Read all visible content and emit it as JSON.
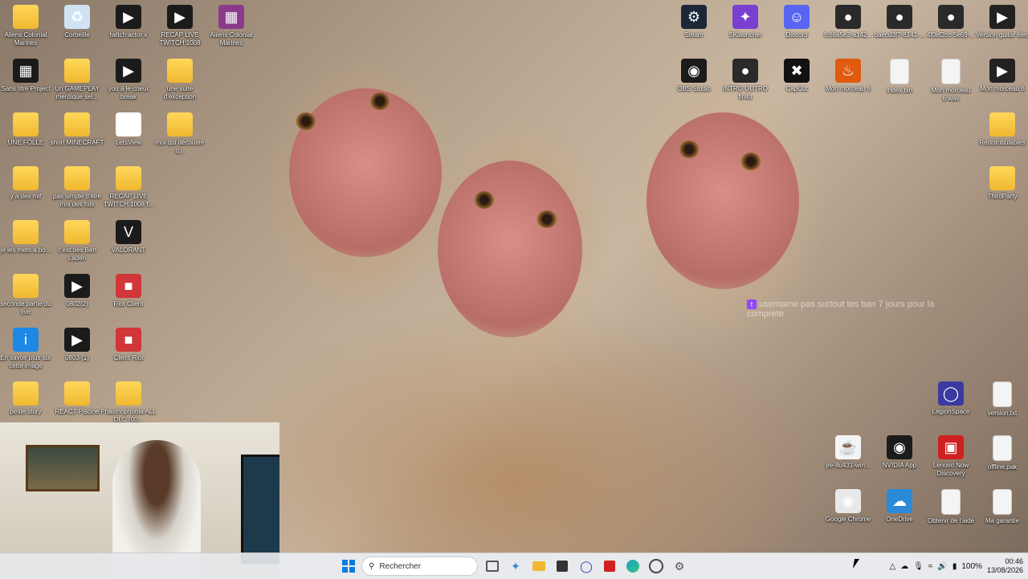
{
  "desktop_icons_left": [
    {
      "label": "Aliens Colonial Marines",
      "icon": "folder-icon"
    },
    {
      "label": "Corbeille",
      "icon": "recycle-bin-icon"
    },
    {
      "label": "twitch actor x",
      "icon": "video-file-icon"
    },
    {
      "label": "RECAP LIVE TWITCH 1008",
      "icon": "video-file-icon"
    },
    {
      "label": "Aliens Colonial Marines",
      "icon": "winrar-icon"
    },
    {
      "label": "Sans titre Project",
      "icon": "project-icon"
    },
    {
      "label": "Un GAMEPLAY merdique sel...",
      "icon": "folder-icon"
    },
    {
      "label": "you à le coeur break",
      "icon": "video-file-icon"
    },
    {
      "label": "une suite d'exception",
      "icon": "folder-icon"
    },
    {
      "label": "UNE FOLLE",
      "icon": "folder-icon"
    },
    {
      "label": "short MINECRAFT",
      "icon": "folder-icon"
    },
    {
      "label": "LetsView",
      "icon": "letsview-icon"
    },
    {
      "label": "moi qui découvre q...",
      "icon": "folder-icon"
    },
    {
      "label": "y a des mif",
      "icon": "folder-icon"
    },
    {
      "label": "pas simple d'être moi des fois",
      "icon": "folder-icon"
    },
    {
      "label": "RECAP LIVE TWITCH 1008 f...",
      "icon": "folder-icon"
    },
    {
      "label": "je les mets a bo...",
      "icon": "folder-icon"
    },
    {
      "label": "c'est des Ben Laden",
      "icon": "folder-icon"
    },
    {
      "label": "VALORANT",
      "icon": "valorant-icon"
    },
    {
      "label": "seconde partie du live",
      "icon": "folder-icon"
    },
    {
      "label": "0802(2)",
      "icon": "video-file-icon"
    },
    {
      "label": "Riot Client",
      "icon": "riot-icon"
    },
    {
      "label": "En savoir plus sur cette image",
      "icon": "info-icon"
    },
    {
      "label": "0803 (1)",
      "icon": "video-file-icon"
    },
    {
      "label": "Client Riot",
      "icon": "riot-icon"
    },
    {
      "label": "petite story",
      "icon": "folder-icon"
    },
    {
      "label": "REACT Piscine",
      "icon": "folder-icon"
    },
    {
      "label": "Phasmophobia ALL DLC (00...",
      "icon": "folder-icon"
    }
  ],
  "desktop_icons_right": [
    {
      "label": "Steam",
      "icon": "steam-icon"
    },
    {
      "label": "SKlauncher",
      "icon": "sklauncher-icon"
    },
    {
      "label": "Discord",
      "icon": "discord-icon"
    },
    {
      "label": "fc68a5e3-a142...",
      "icon": "photo-icon"
    },
    {
      "label": "baecd3f7-8141-...",
      "icon": "photo-icon"
    },
    {
      "label": "4f0ef2cc-5e69-...",
      "icon": "photo-icon"
    },
    {
      "label": "Version guitar élec",
      "icon": "media-icon"
    },
    {
      "label": "OBS Studio",
      "icon": "obs-icon"
    },
    {
      "label": "INTRO OUTRO finito",
      "icon": "photo-icon"
    },
    {
      "label": "CapCut",
      "icon": "capcut-icon"
    },
    {
      "label": "Mon morceau 6",
      "icon": "flstudio-icon"
    },
    {
      "label": "index.bin",
      "icon": "file-icon"
    },
    {
      "label": "Mon morceau 6.wav",
      "icon": "file-icon"
    },
    {
      "label": "Mon morceau 6",
      "icon": "media-icon"
    },
    {
      "label": "Redistributables",
      "icon": "folder-icon"
    },
    {
      "label": "ThirdParty",
      "icon": "folder-icon"
    },
    {
      "label": "LegionSpace",
      "icon": "legion-icon"
    },
    {
      "label": "version.txt",
      "icon": "file-icon"
    },
    {
      "label": "jre-8u431-win...",
      "icon": "java-icon"
    },
    {
      "label": "NVIDIA App",
      "icon": "nvidia-icon"
    },
    {
      "label": "Lenovo Now Discovery",
      "icon": "lenovo-icon"
    },
    {
      "label": "offline.pak",
      "icon": "file-icon"
    },
    {
      "label": "Google Chrome",
      "icon": "chrome-icon"
    },
    {
      "label": "OneDrive",
      "icon": "onedrive-icon"
    },
    {
      "label": "Obtenir de l'aide",
      "icon": "file-icon"
    },
    {
      "label": "Ma garantie",
      "icon": "file-icon"
    }
  ],
  "chat_overlay": {
    "user": "username",
    "message": "pas surtout tes ban 7 jours pour la comprete"
  },
  "taskbar": {
    "search_placeholder": "Rechercher",
    "battery": "100%",
    "time": "00:46",
    "date": "13/08/2026"
  },
  "colors": {
    "taskbar_bg": "#e6e8ec",
    "twitch": "#9146ff",
    "folder": "#f0b830"
  }
}
